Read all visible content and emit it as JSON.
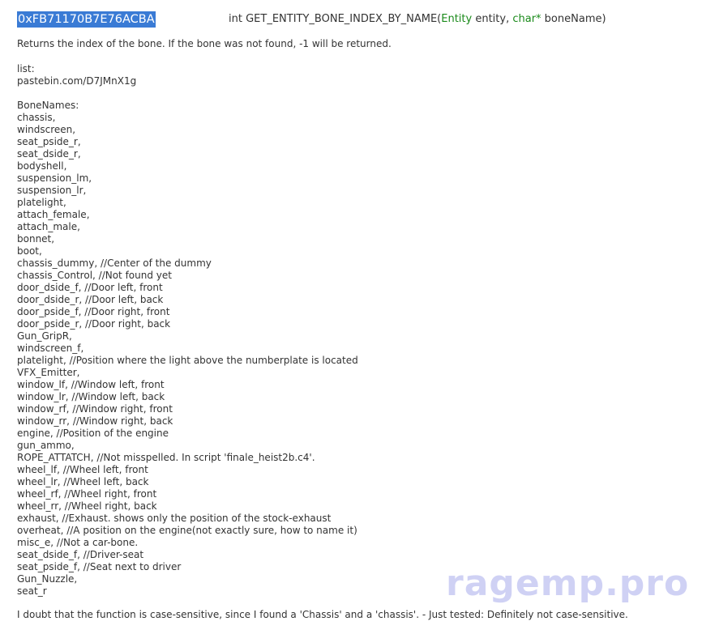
{
  "header": {
    "hash": "0xFB71170B7E76ACBA",
    "return_type": "int",
    "function_name": "GET_ENTITY_BONE_INDEX_BY_NAME",
    "open_paren": "(",
    "param1_type": "Entity",
    "param1_name": " entity, ",
    "param2_type": "char*",
    "param2_name": " boneName)"
  },
  "description": "Returns the index of the bone. If the bone was not found, -1 will be returned.",
  "lines": [
    "list:",
    "pastebin.com/D7JMnX1g",
    "",
    "BoneNames:",
    "chassis,",
    "windscreen,",
    "seat_pside_r,",
    "seat_dside_r,",
    "bodyshell,",
    "suspension_lm,",
    "suspension_lr,",
    "platelight,",
    "attach_female,",
    "attach_male,",
    "bonnet,",
    "boot,",
    "chassis_dummy, //Center of the dummy",
    "chassis_Control, //Not found yet",
    "door_dside_f, //Door left, front",
    "door_dside_r, //Door left, back",
    "door_pside_f, //Door right, front",
    "door_pside_r, //Door right, back",
    "Gun_GripR,",
    "windscreen_f,",
    "platelight, //Position where the light above the numberplate is located",
    "VFX_Emitter,",
    "window_lf, //Window left, front",
    "window_lr, //Window left, back",
    "window_rf, //Window right, front",
    "window_rr, //Window right, back",
    "engine, //Position of the engine",
    "gun_ammo,",
    "ROPE_ATTATCH, //Not misspelled. In script 'finale_heist2b.c4'.",
    "wheel_lf, //Wheel left, front",
    "wheel_lr, //Wheel left, back",
    "wheel_rf, //Wheel right, front",
    "wheel_rr, //Wheel right, back",
    "exhaust, //Exhaust. shows only the position of the stock-exhaust",
    "overheat, //A position on the engine(not exactly sure, how to name it)",
    "misc_e, //Not a car-bone.",
    "seat_dside_f, //Driver-seat",
    "seat_pside_f, //Seat next to driver",
    "Gun_Nuzzle,",
    "seat_r"
  ],
  "footer": "I doubt that the function is case-sensitive, since I found a 'Chassis' and a 'chassis'. - Just tested: Definitely not case-sensitive.",
  "watermark": "ragemp.pro",
  "colors": {
    "hash_highlight": "#3a7bd5",
    "type_green": "#1a8a1a",
    "text": "#333333",
    "watermark": "#6b73e0"
  }
}
